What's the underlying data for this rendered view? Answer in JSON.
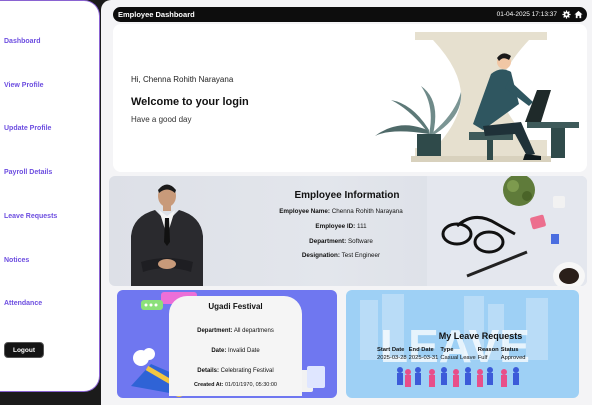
{
  "sidebar": {
    "items": [
      {
        "label": "Dashboard"
      },
      {
        "label": "View Profile"
      },
      {
        "label": "Update Profile"
      },
      {
        "label": "Payroll Details"
      },
      {
        "label": "Leave Requests"
      },
      {
        "label": "Notices"
      },
      {
        "label": "Attendance"
      }
    ],
    "logout_label": "Logout"
  },
  "header": {
    "title": "Employee Dashboard",
    "datetime": "01-04-2025 17:13:37",
    "settings_icon": "gear-icon",
    "home_icon": "home-icon"
  },
  "welcome": {
    "greeting": "Hi, Chenna Rohith Narayana",
    "title": "Welcome to your login",
    "subtitle": "Have a good day"
  },
  "employee_info": {
    "title": "Employee Information",
    "name_label": "Employee Name:",
    "name": "Chenna Rohith Narayana",
    "id_label": "Employee ID:",
    "id": "111",
    "department_label": "Department:",
    "department": "Software",
    "designation_label": "Designation:",
    "designation": "Test Engineer"
  },
  "notice": {
    "title": "Ugadi Festival",
    "department_label": "Department:",
    "department": "All departmens",
    "date_label": "Date:",
    "date": "Invalid Date",
    "details_label": "Details:",
    "details": "Celebrating Festival",
    "created_label": "Created At:",
    "created": "01/01/1970, 05:30:00"
  },
  "leave_requests": {
    "title": "My Leave Requests",
    "columns": [
      "Start Date",
      "End Date",
      "Type",
      "Reason",
      "Status"
    ],
    "rows": [
      [
        "2025-03-28",
        "2025-03-31",
        "Casual Leave",
        "Fulf",
        "Approved"
      ]
    ],
    "background_text": "LEAVE"
  },
  "colors": {
    "accent": "#6d4ee0",
    "sidebar_border": "#8a63d2",
    "topbar": "#0d0d0d",
    "notice_bg": "#6f77f0",
    "leave_bg": "#9ed0f5"
  }
}
